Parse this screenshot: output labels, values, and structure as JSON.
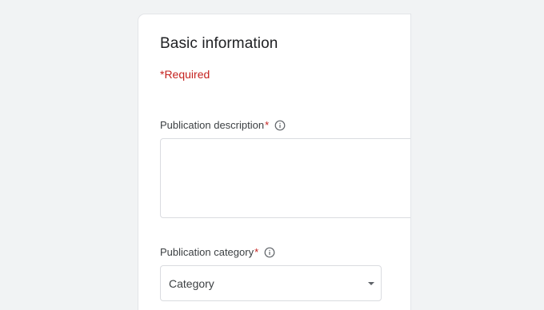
{
  "form": {
    "title": "Basic information",
    "required_note": "*Required",
    "description": {
      "label": "Publication description",
      "required_mark": "*",
      "value": ""
    },
    "category": {
      "label": "Publication category",
      "required_mark": "*",
      "selected": "Category"
    }
  },
  "colors": {
    "background": "#f1f3f4",
    "required": "#c5221f",
    "border": "#dadce0"
  },
  "icons": {
    "info": "info-icon",
    "dropdown": "chevron-down-icon"
  }
}
